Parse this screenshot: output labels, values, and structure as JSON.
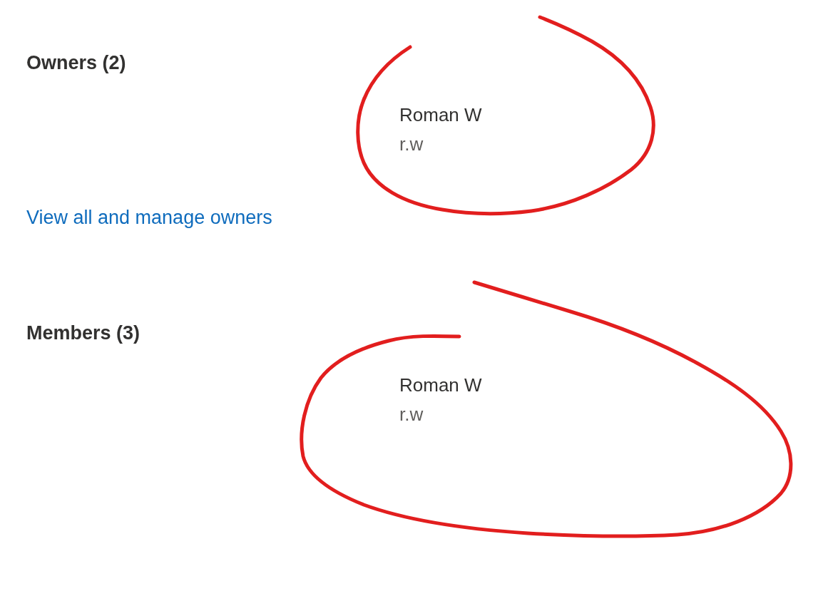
{
  "sections": [
    {
      "heading": "Owners (2)",
      "people": [
        {
          "name": "Roman W",
          "email": "r.w"
        }
      ],
      "link": "View all and manage owners"
    },
    {
      "heading": "Members (3)",
      "people": [
        {
          "name": "Roman W",
          "email": "r.w"
        }
      ]
    }
  ]
}
